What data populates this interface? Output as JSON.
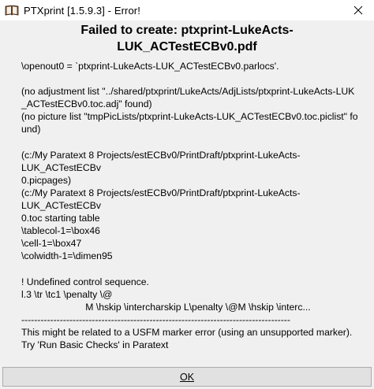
{
  "window": {
    "title": "PTXprint [1.5.9.3] - Error!"
  },
  "header": {
    "line1": "Failed to create: ptxprint-LukeActs-",
    "line2": "LUK_ACTestECBv0.pdf"
  },
  "message": {
    "lines": [
      "\\openout0 = `ptxprint-LukeActs-LUK_ACTestECBv0.parlocs'.",
      "",
      "(no adjustment list \"../shared/ptxprint/LukeActs/AdjLists/ptxprint-LukeActs-LUK",
      "_ACTestECBv0.toc.adj\" found)",
      "(no picture list \"tmpPicLists/ptxprint-LukeActs-LUK_ACTestECBv0.toc.piclist\" fo",
      "und)",
      "",
      "(c:/My Paratext 8 Projects/estECBv0/PrintDraft/ptxprint-LukeActs-",
      "LUK_ACTestECBv",
      "0.picpages)",
      "(c:/My Paratext 8 Projects/estECBv0/PrintDraft/ptxprint-LukeActs-",
      "LUK_ACTestECBv",
      "0.toc starting table",
      "\\tablecol-1=\\box46",
      "\\cell-1=\\box47",
      "\\colwidth-1=\\dimen95",
      "",
      "! Undefined control sequence.",
      "l.3 \\tr \\tc1 \\penalty \\@",
      "                        M \\hskip \\intercharskip L\\penalty \\@M \\hskip \\interc...",
      "------------------------------------------------------------------------------------",
      "This might be related to a USFM marker error (using an unsupported marker).",
      "Try 'Run Basic Checks' in Paratext"
    ]
  },
  "buttons": {
    "ok_label": "OK"
  },
  "icons": {
    "app": "book-icon",
    "close": "close-icon"
  }
}
